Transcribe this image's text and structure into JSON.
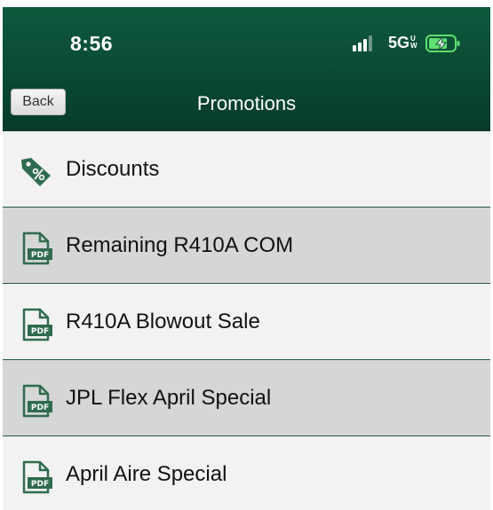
{
  "status_bar": {
    "time": "8:56",
    "network": "5G",
    "network_suffix": "UW",
    "signal_icon": "cellular-signal-icon",
    "battery_icon": "battery-charging-icon"
  },
  "nav": {
    "back_label": "Back",
    "title": "Promotions"
  },
  "list": {
    "items": [
      {
        "label": "Discounts",
        "icon": "discount-tag-icon"
      },
      {
        "label": "Remaining R410A COM",
        "icon": "pdf-icon"
      },
      {
        "label": "R410A Blowout Sale",
        "icon": "pdf-icon"
      },
      {
        "label": "JPL Flex April Special",
        "icon": "pdf-icon"
      },
      {
        "label": "April Aire Special",
        "icon": "pdf-icon"
      }
    ]
  },
  "colors": {
    "header_top": "#0e5a3e",
    "header_bottom": "#073c29",
    "row_light": "#f2f2f2",
    "row_dark": "#d6d6d6",
    "divider": "#1f5a42",
    "icon_green": "#2f6b4e"
  }
}
